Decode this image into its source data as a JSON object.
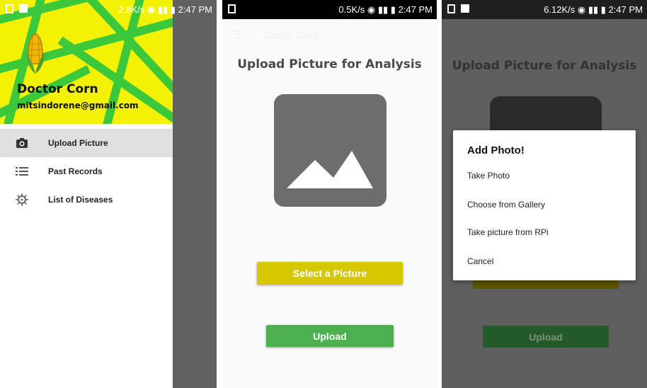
{
  "status_bars": [
    {
      "speed": "2.8K/s",
      "time": "2:47 PM"
    },
    {
      "speed": "0.5K/s",
      "time": "2:47 PM"
    },
    {
      "speed": "6.12K/s",
      "time": "2:47 PM"
    }
  ],
  "drawer": {
    "app_name": "Doctor Corn",
    "email": "mitsindorene@gmail.com",
    "items": [
      {
        "label": "Upload Picture",
        "icon": "camera-icon",
        "active": true
      },
      {
        "label": "Past Records",
        "icon": "list-icon",
        "active": false
      },
      {
        "label": "List of Diseases",
        "icon": "virus-icon",
        "active": false
      }
    ]
  },
  "upload_screen": {
    "toolbar_title": "Doctor Corn",
    "heading": "Upload Picture for Analysis",
    "select_button": "Select a Picture",
    "upload_button": "Upload"
  },
  "dialog_screen": {
    "heading": "Upload Picture for Analysis",
    "upload_button": "Upload",
    "dialog": {
      "title": "Add Photo!",
      "options": [
        "Take Photo",
        "Choose from Gallery",
        "Take picture from RPi",
        "Cancel"
      ]
    }
  },
  "colors": {
    "header_yellow": "#f3f206",
    "header_green": "#3bc93b",
    "select_button": "#d6c700",
    "upload_button": "#4caf50",
    "placeholder_gray": "#6d6d6d"
  }
}
